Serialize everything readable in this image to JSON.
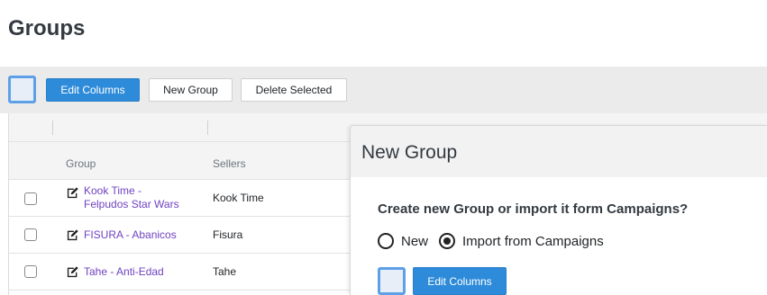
{
  "page": {
    "title": "Groups"
  },
  "toolbar": {
    "edit_columns": "Edit Columns",
    "new_group": "New Group",
    "delete_selected": "Delete Selected"
  },
  "table": {
    "columns": [
      "Group",
      "Sellers"
    ],
    "rows": [
      {
        "group_line1": "Kook Time -",
        "group_line2": "Felpudos Star Wars",
        "seller": "Kook Time"
      },
      {
        "group_line1": "FISURA - Abanicos",
        "seller": "Fisura"
      },
      {
        "group_line1": "Tahe - Anti-Edad",
        "seller": "Tahe"
      }
    ]
  },
  "modal": {
    "title": "New Group",
    "question": "Create new Group or import it form Campaigns?",
    "options": [
      {
        "label": "New",
        "selected": false
      },
      {
        "label": "Import from Campaigns",
        "selected": true
      }
    ],
    "edit_columns": "Edit Columns"
  },
  "colors": {
    "primary": "#2e8bd9",
    "link": "#6f42c1",
    "checkbox_border": "#5ea0e8"
  }
}
